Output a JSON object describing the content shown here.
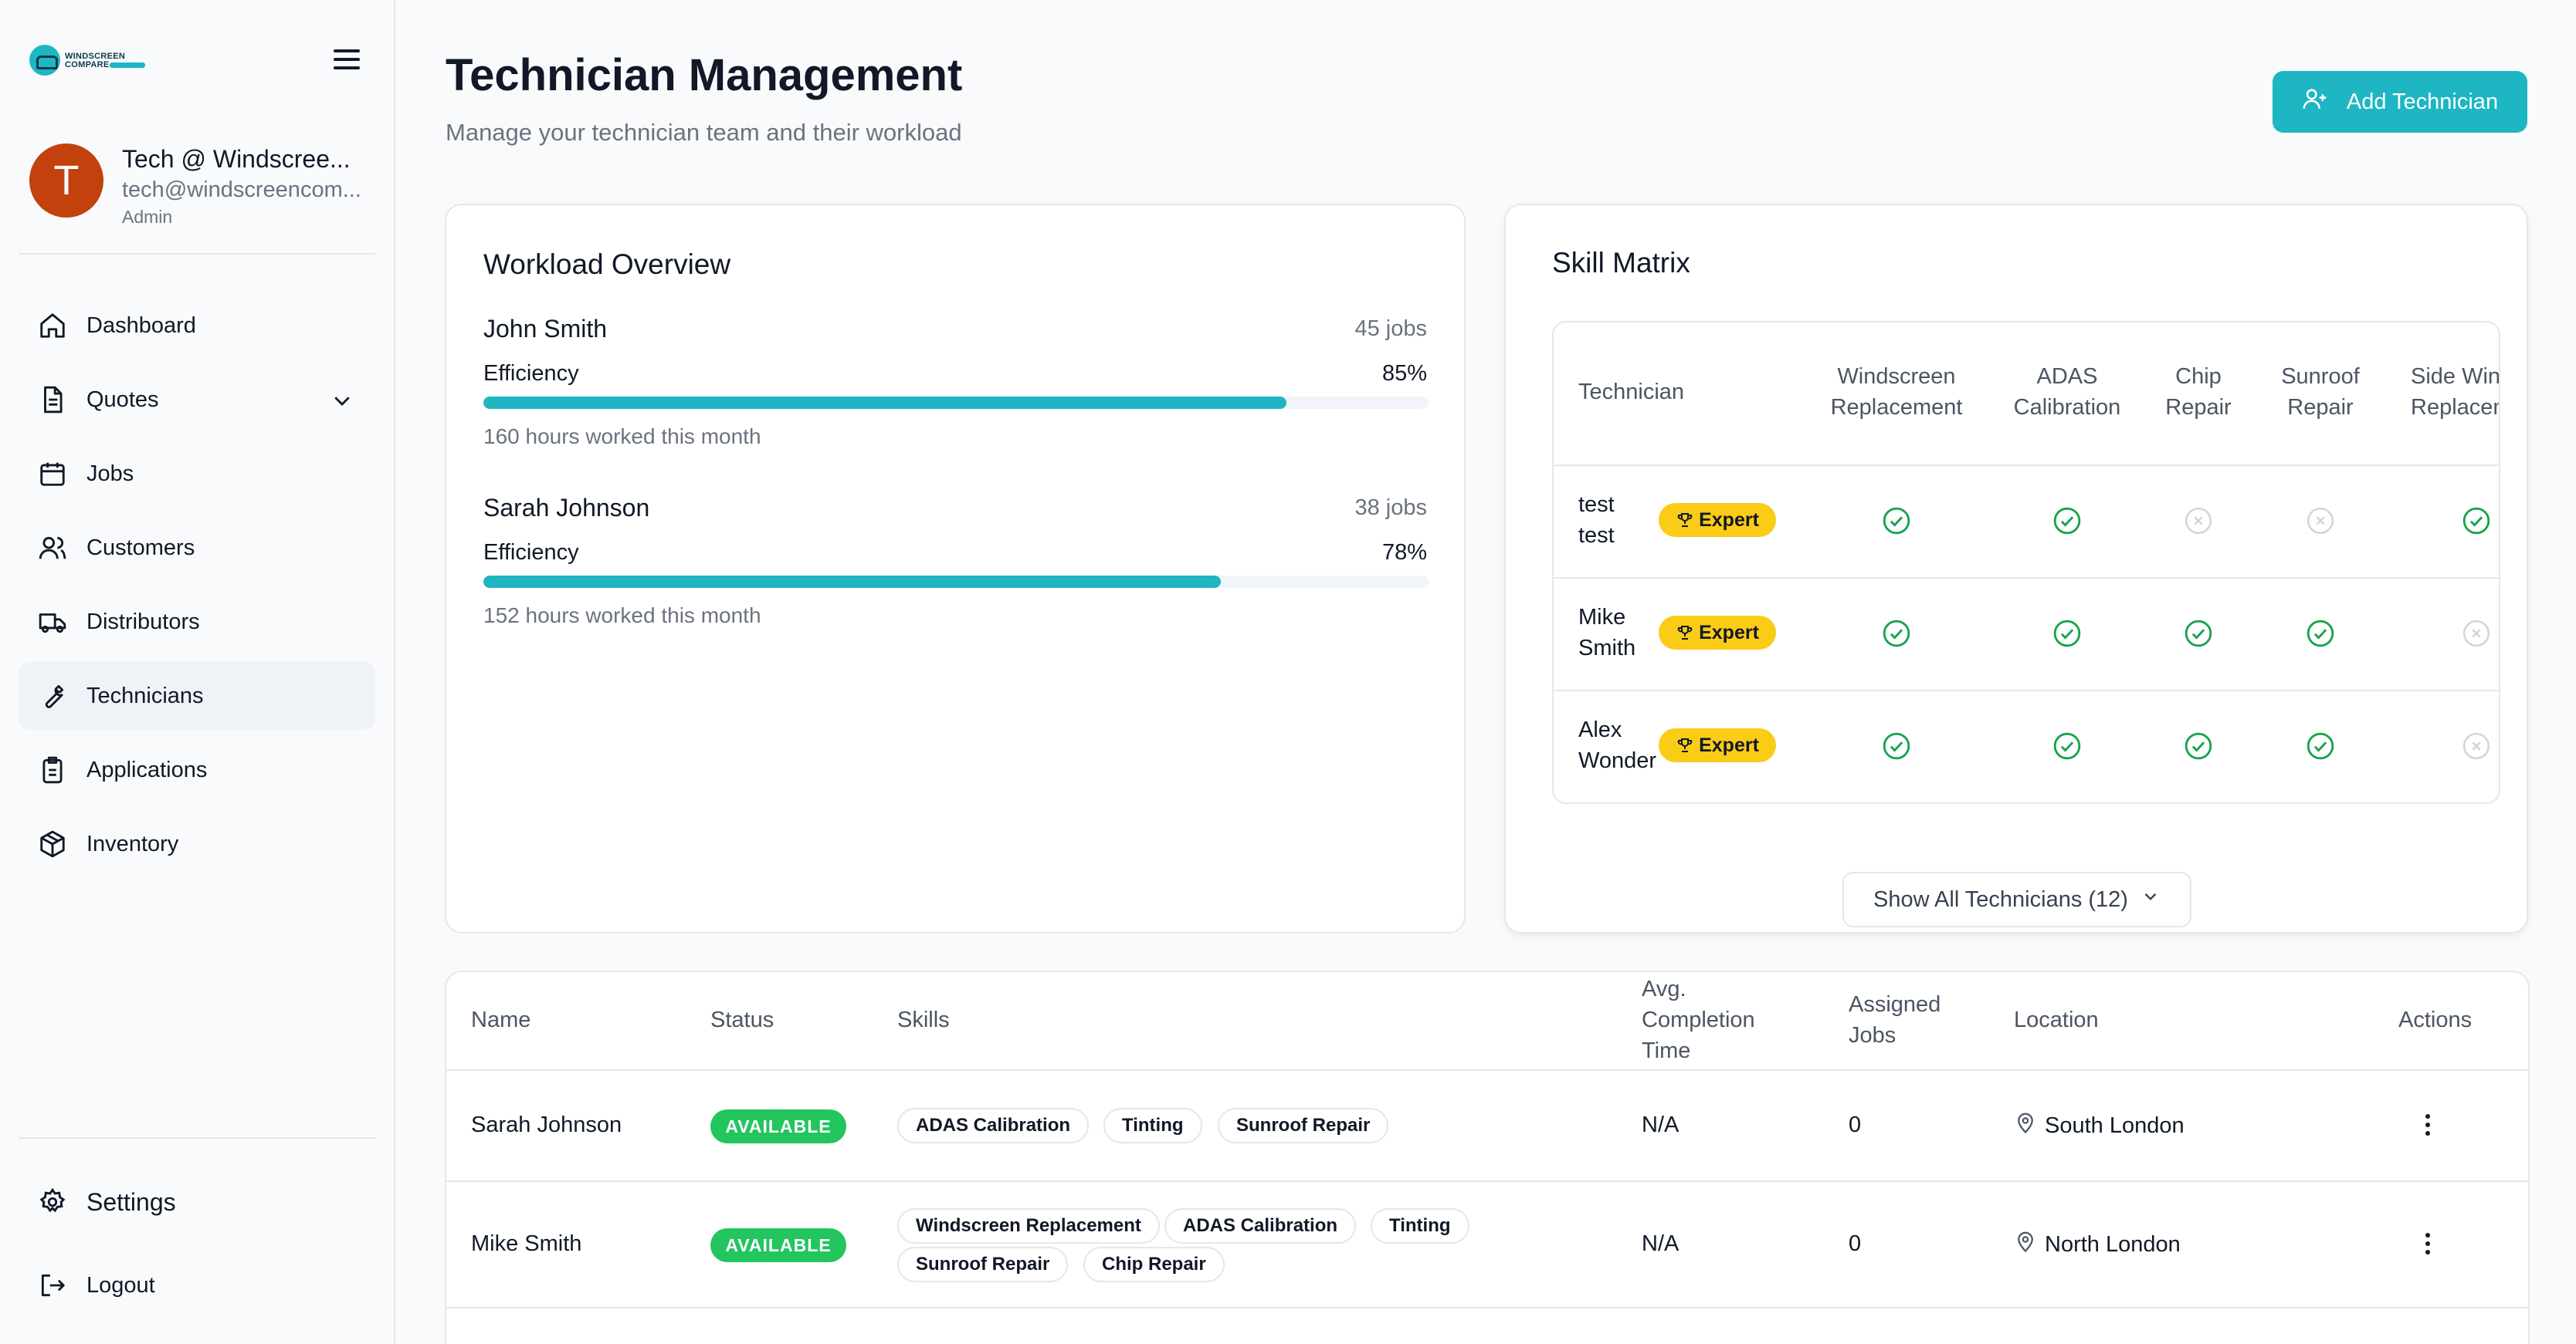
{
  "brand": {
    "logo_text": "WINDSCREEN COMPARE",
    "accent": "#1eb6c3"
  },
  "user": {
    "initial": "T",
    "name": "Tech @ Windscree...",
    "email": "tech@windscreencom...",
    "role": "Admin"
  },
  "nav": {
    "dashboard": "Dashboard",
    "quotes": "Quotes",
    "jobs": "Jobs",
    "customers": "Customers",
    "distributors": "Distributors",
    "technicians": "Technicians",
    "applications": "Applications",
    "inventory": "Inventory",
    "settings": "Settings",
    "logout": "Logout"
  },
  "header": {
    "title": "Technician Management",
    "subtitle": "Manage your technician team and their workload",
    "add_button": "Add Technician"
  },
  "workload": {
    "title": "Workload Overview",
    "items": [
      {
        "name": "John Smith",
        "jobs": "45 jobs",
        "efficiency_label": "Efficiency",
        "efficiency": "85%",
        "efficiency_value": 85,
        "hours": "160 hours worked this month"
      },
      {
        "name": "Sarah Johnson",
        "jobs": "38 jobs",
        "efficiency_label": "Efficiency",
        "efficiency": "78%",
        "efficiency_value": 78,
        "hours": "152 hours worked this month"
      }
    ]
  },
  "skill_matrix": {
    "title": "Skill Matrix",
    "columns": {
      "technician": "Technician",
      "c1a": "Windscreen",
      "c1b": "Replacement",
      "c2a": "ADAS",
      "c2b": "Calibration",
      "c3a": "Chip",
      "c3b": "Repair",
      "c4a": "Sunroof",
      "c4b": "Repair",
      "c5a": "Side Win",
      "c5b": "Replacem"
    },
    "rows": [
      {
        "name1": "test",
        "name2": "test",
        "badge": "Expert",
        "skills": [
          true,
          true,
          false,
          false,
          true
        ]
      },
      {
        "name1": "Mike",
        "name2": "Smith",
        "badge": "Expert",
        "skills": [
          true,
          true,
          true,
          true,
          false
        ]
      },
      {
        "name1": "Alex",
        "name2": "Wonder",
        "badge": "Expert",
        "skills": [
          true,
          true,
          true,
          true,
          false
        ]
      }
    ],
    "show_all": "Show All Technicians (12)"
  },
  "table": {
    "headers": {
      "name": "Name",
      "status": "Status",
      "skills": "Skills",
      "avg1": "Avg.",
      "avg2": "Completion",
      "avg3": "Time",
      "assigned1": "Assigned",
      "assigned2": "Jobs",
      "location": "Location",
      "actions": "Actions"
    },
    "rows": [
      {
        "name": "Sarah Johnson",
        "status": "AVAILABLE",
        "skills": [
          "ADAS Calibration",
          "Tinting",
          "Sunroof Repair"
        ],
        "avg_time": "N/A",
        "assigned": "0",
        "location": "South London"
      },
      {
        "name": "Mike Smith",
        "status": "AVAILABLE",
        "skills": [
          "Windscreen Replacement",
          "ADAS Calibration",
          "Tinting",
          "Sunroof Repair",
          "Chip Repair"
        ],
        "avg_time": "N/A",
        "assigned": "0",
        "location": "North London"
      }
    ]
  }
}
